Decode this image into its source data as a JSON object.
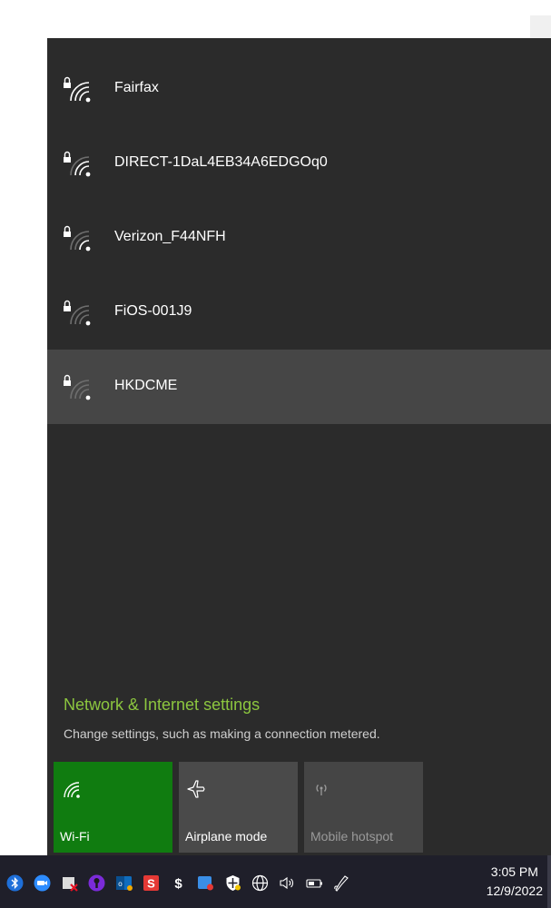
{
  "networks": [
    {
      "name": "Fairfax",
      "secured": true,
      "signal": 4,
      "selected": false
    },
    {
      "name": "DIRECT-1DaL4EB34A6EDGOq0",
      "secured": true,
      "signal": 3,
      "selected": false
    },
    {
      "name": "Verizon_F44NFH",
      "secured": true,
      "signal": 2,
      "selected": false
    },
    {
      "name": "FiOS-001J9",
      "secured": true,
      "signal": 1,
      "selected": false
    },
    {
      "name": "HKDCME",
      "secured": true,
      "signal": 1,
      "selected": true
    }
  ],
  "settings": {
    "link_text": "Network & Internet settings",
    "description": "Change settings, such as making a connection metered."
  },
  "quick_actions": {
    "wifi_label": "Wi-Fi",
    "airplane_label": "Airplane mode",
    "hotspot_label": "Mobile hotspot"
  },
  "taskbar": {
    "time": "3:05 PM",
    "date": "12/9/2022",
    "tray_icons": [
      "bluetooth-icon",
      "zoom-icon",
      "security-shield-icon",
      "vpn-icon",
      "outlook-icon",
      "s-app-icon",
      "dollar-icon",
      "app-icon",
      "defender-icon",
      "globe-icon",
      "speaker-icon",
      "battery-icon",
      "pen-icon"
    ]
  },
  "colors": {
    "flyout_bg": "#2b2b2b",
    "selected_row": "#464646",
    "link_green": "#8cc63f",
    "wifi_tile": "#107c10",
    "tile_gray": "#4a4a4a",
    "taskbar_bg": "#1f1f2a"
  }
}
